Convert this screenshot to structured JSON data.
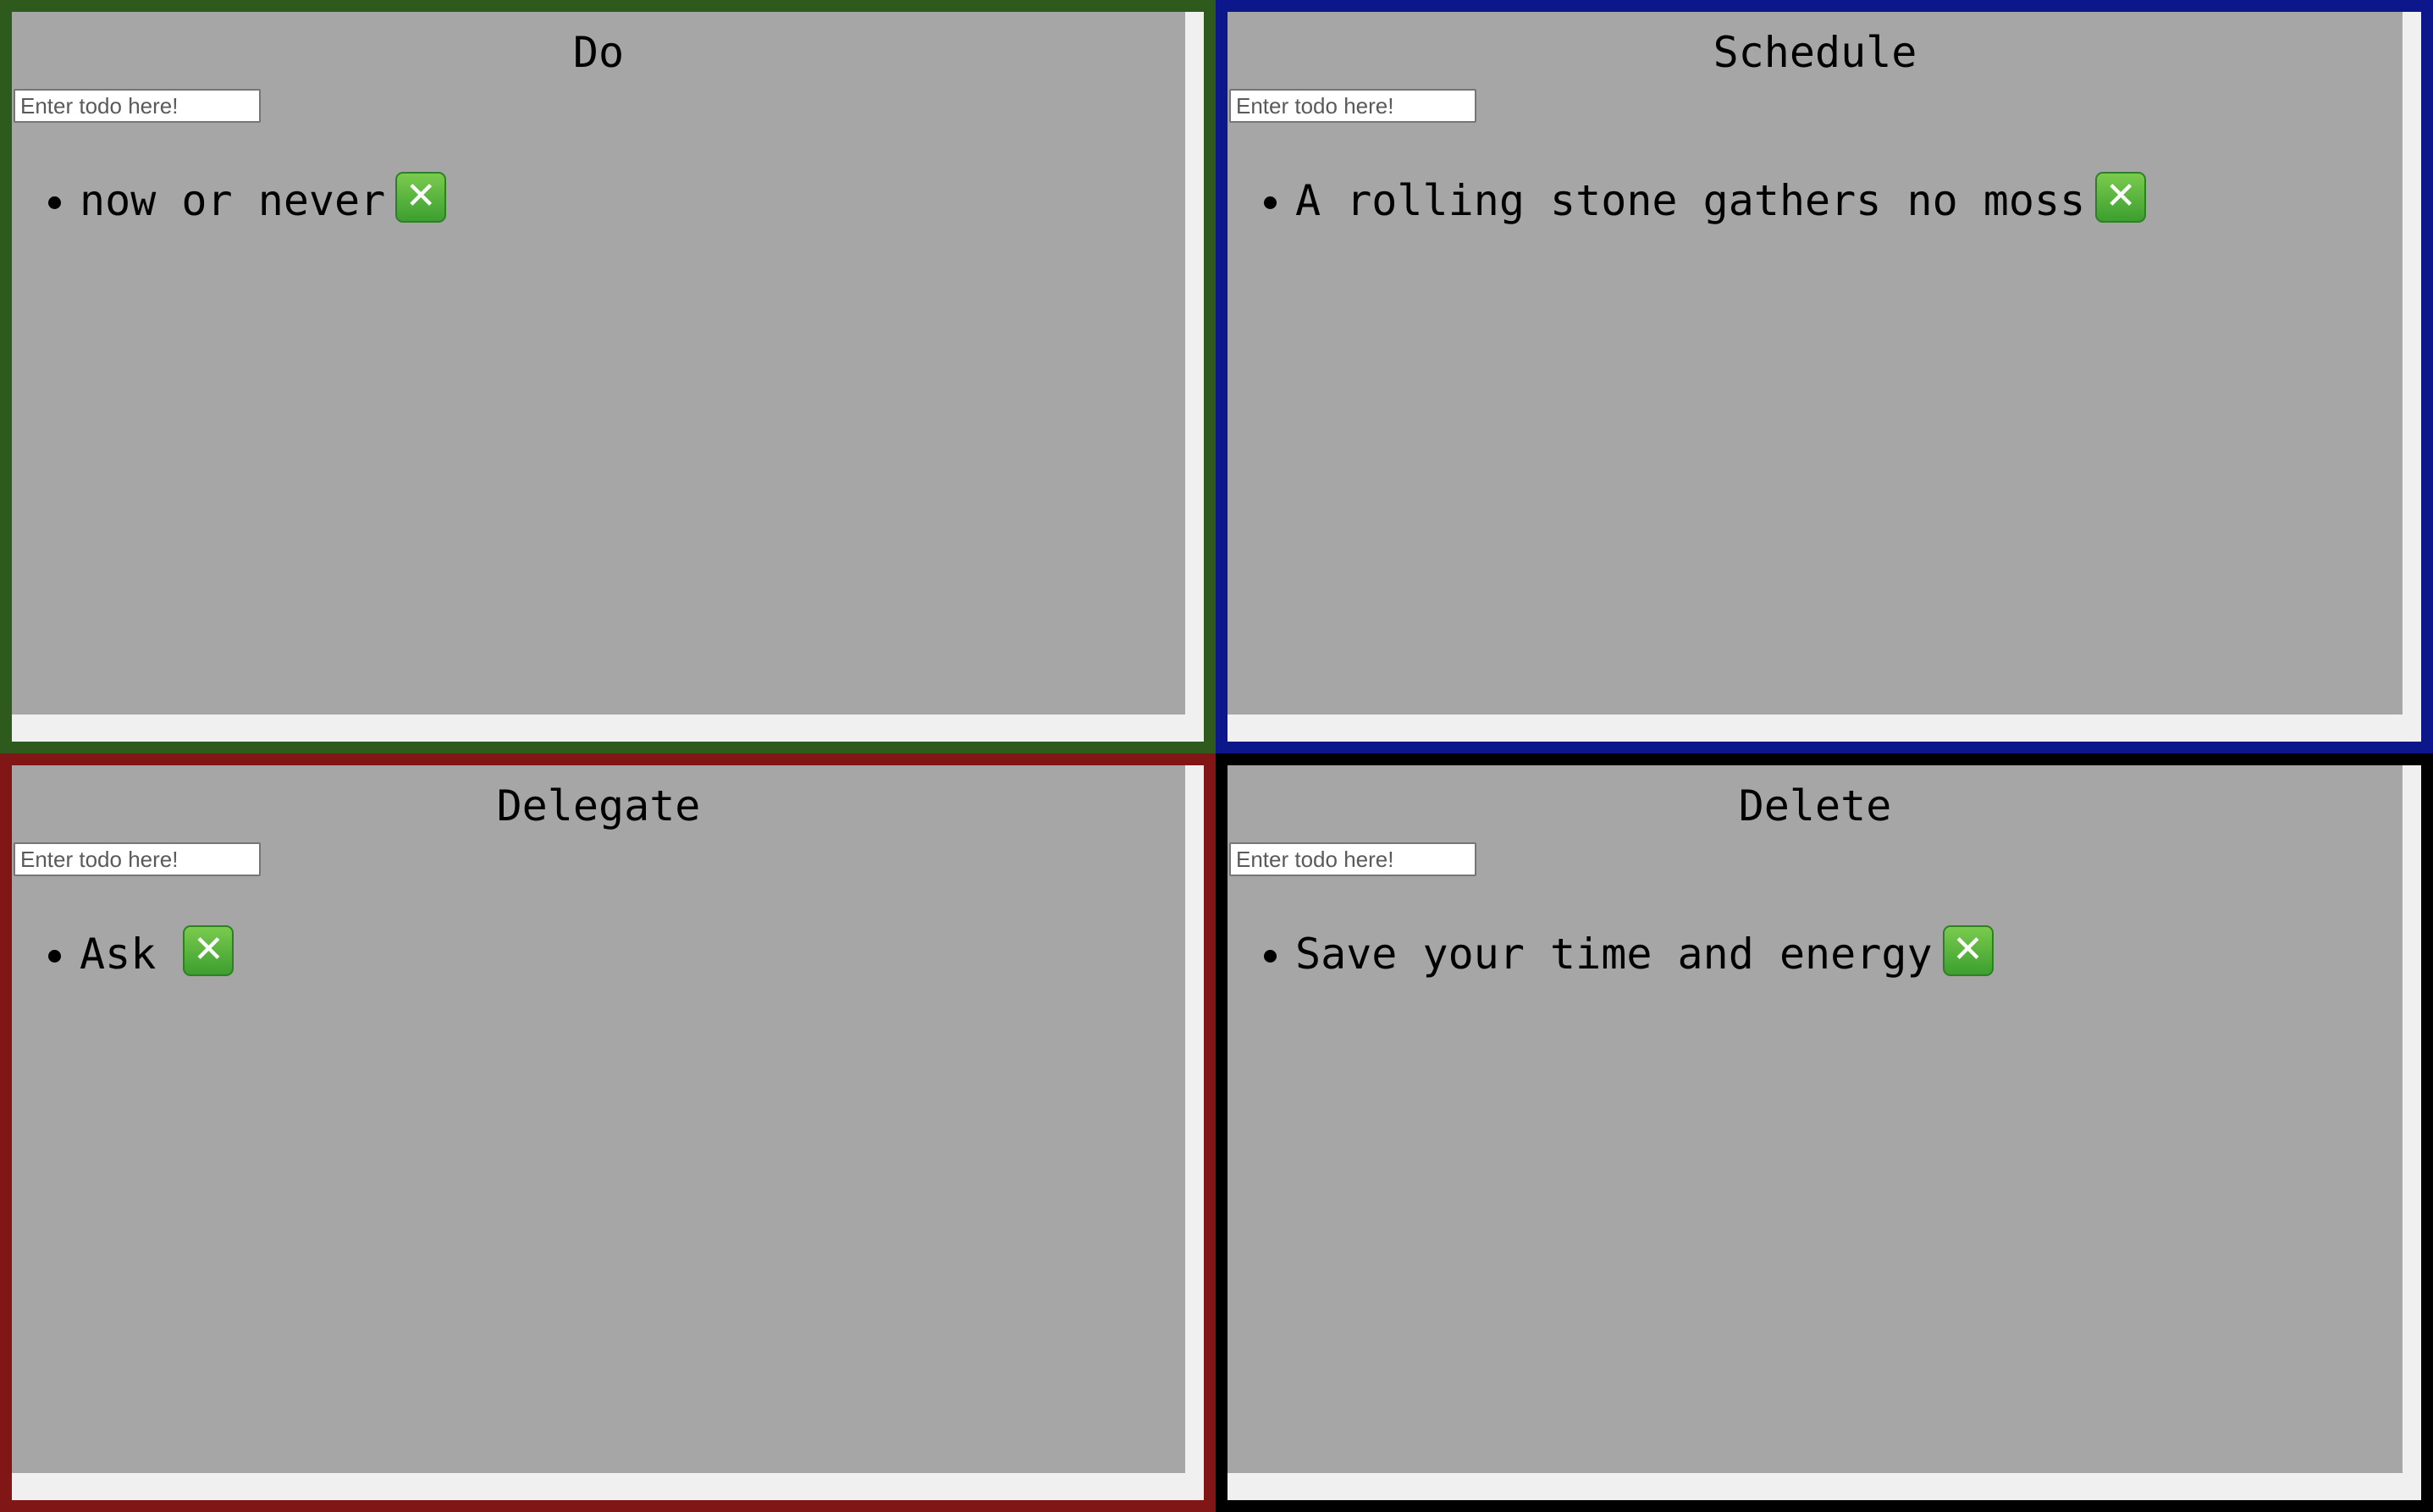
{
  "colors": {
    "do": "#2f5a1e",
    "schedule": "#0d178c",
    "delegate": "#801616",
    "delete": "#000000",
    "panel_bg": "#a6a6a6",
    "remove_button": "#4caf3a"
  },
  "quadrants": [
    {
      "id": "do",
      "title": "Do",
      "input_placeholder": "Enter todo here!",
      "items": [
        {
          "text": "now or never",
          "remove_icon": "cross-mark-button-icon",
          "remove_symbol": "✕"
        }
      ]
    },
    {
      "id": "schedule",
      "title": "Schedule",
      "input_placeholder": "Enter todo here!",
      "items": [
        {
          "text": "A rolling stone gathers no moss",
          "remove_icon": "cross-mark-button-icon",
          "remove_symbol": "✕"
        }
      ]
    },
    {
      "id": "delegate",
      "title": "Delegate",
      "input_placeholder": "Enter todo here!",
      "items": [
        {
          "text": "Ask ",
          "remove_icon": "cross-mark-button-icon",
          "remove_symbol": "✕"
        }
      ]
    },
    {
      "id": "delete",
      "title": "Delete",
      "input_placeholder": "Enter todo here!",
      "items": [
        {
          "text": "Save your time and energy",
          "remove_icon": "cross-mark-button-icon",
          "remove_symbol": "✕"
        }
      ]
    }
  ]
}
